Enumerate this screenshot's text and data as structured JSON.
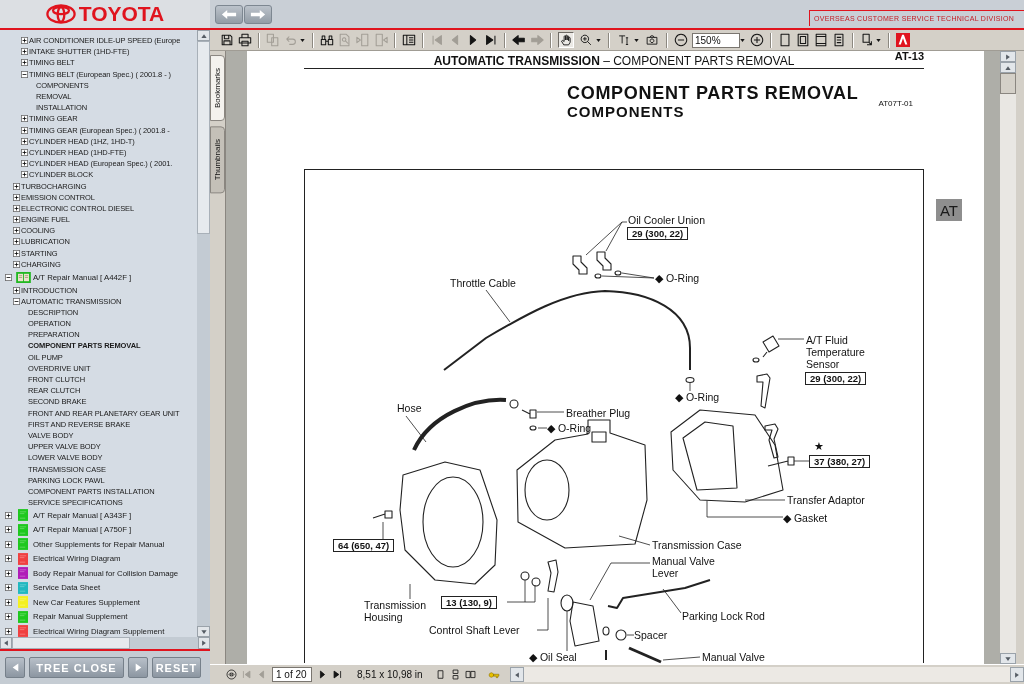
{
  "header": {
    "logo": "TOYOTA",
    "division": "OVERSEAS CUSTOMER SERVICE TECHNICAL DIVISION"
  },
  "tree": {
    "section_items": [
      {
        "label": "AIR CONDITIONER IDLE-UP SPEED (Europe",
        "expanded": false,
        "selected": false
      },
      {
        "label": "INTAKE SHUTTER (1HD-FTE)",
        "expanded": false,
        "selected": false
      },
      {
        "label": "TIMING BELT",
        "expanded": false,
        "selected": false
      },
      {
        "label": "TIMING BELT (European Spec.) ( 2001.8 - )",
        "expanded": true,
        "selected": false,
        "children": [
          {
            "label": "COMPONENTS",
            "selected": false
          },
          {
            "label": "REMOVAL",
            "selected": false
          },
          {
            "label": "INSTALLATION",
            "selected": false
          }
        ]
      },
      {
        "label": "TIMING GEAR",
        "expanded": false,
        "selected": false
      },
      {
        "label": "TIMING GEAR (European Spec.) ( 2001.8 -",
        "expanded": false,
        "selected": false
      },
      {
        "label": "CYLINDER HEAD (1HZ, 1HD-T)",
        "expanded": false,
        "selected": false
      },
      {
        "label": "CYLINDER HEAD (1HD-FTE)",
        "expanded": false,
        "selected": false
      },
      {
        "label": "CYLINDER HEAD (European Spec.) ( 2001.",
        "expanded": false,
        "selected": false
      },
      {
        "label": "CYLINDER BLOCK",
        "expanded": false,
        "selected": false
      }
    ],
    "manual_items": [
      {
        "label": "TURBOCHARGING",
        "expanded": false,
        "selected": false
      },
      {
        "label": "EMISSION CONTROL",
        "expanded": false,
        "selected": false
      },
      {
        "label": "ELECTRONIC CONTROL DIESEL",
        "expanded": false,
        "selected": false
      },
      {
        "label": "ENGINE FUEL",
        "expanded": false,
        "selected": false
      },
      {
        "label": "COOLING",
        "expanded": false,
        "selected": false
      },
      {
        "label": "LUBRICATION",
        "expanded": false,
        "selected": false
      },
      {
        "label": "STARTING",
        "expanded": false,
        "selected": false
      },
      {
        "label": "CHARGING",
        "expanded": false,
        "selected": false
      }
    ],
    "manuals": [
      {
        "label": "A/T Repair Manual [ A442F ]",
        "color": "#22b822",
        "expanded": true,
        "selected": false,
        "children": [
          {
            "label": "INTRODUCTION",
            "expanded": false,
            "selected": false
          },
          {
            "label": "AUTOMATIC TRANSMISSION",
            "expanded": true,
            "selected": false,
            "children": [
              {
                "label": "DESCRIPTION",
                "selected": false
              },
              {
                "label": "OPERATION",
                "selected": false
              },
              {
                "label": "PREPARATION",
                "selected": false
              },
              {
                "label": "COMPONENT PARTS REMOVAL",
                "selected": true
              },
              {
                "label": "OIL PUMP",
                "selected": false
              },
              {
                "label": "OVERDRIVE UNIT",
                "selected": false
              },
              {
                "label": "FRONT CLUTCH",
                "selected": false
              },
              {
                "label": "REAR CLUTCH",
                "selected": false
              },
              {
                "label": "SECOND BRAKE",
                "selected": false
              },
              {
                "label": "FRONT AND REAR PLANETARY GEAR UNIT",
                "selected": false
              },
              {
                "label": "FIRST AND REVERSE BRAKE",
                "selected": false
              },
              {
                "label": "VALVE BODY",
                "selected": false
              },
              {
                "label": "UPPER VALVE BODY",
                "selected": false
              },
              {
                "label": "LOWER VALVE BODY",
                "selected": false
              },
              {
                "label": "TRANSMISSION CASE",
                "selected": false
              },
              {
                "label": "PARKING LOCK PAWL",
                "selected": false
              },
              {
                "label": "COMPONENT PARTS INSTALLATION",
                "selected": false
              },
              {
                "label": "SERVICE SPECIFICATIONS",
                "selected": false
              }
            ]
          }
        ]
      },
      {
        "label": "A/T Repair Manual [ A343F ]",
        "color": "#1ec81e",
        "expanded": false,
        "selected": false
      },
      {
        "label": "A/T Repair Manual [ A750F ]",
        "color": "#1ec81e",
        "expanded": false,
        "selected": false
      },
      {
        "label": "Other Supplements for Repair Manual",
        "color": "#1ec81e",
        "expanded": false,
        "selected": false
      },
      {
        "label": "Electrical Wiring Diagram",
        "color": "#f04040",
        "expanded": false,
        "selected": false
      },
      {
        "label": "Body Repair Manual for Collision Damage",
        "color": "#b01cb8",
        "expanded": false,
        "selected": false
      },
      {
        "label": "Service Data Sheet",
        "color": "#20b8c0",
        "expanded": false,
        "selected": false
      },
      {
        "label": "New Car Features Supplement",
        "color": "#f4f020",
        "expanded": false,
        "selected": false
      },
      {
        "label": "Repair Manual Supplement",
        "color": "#1ec81e",
        "expanded": false,
        "selected": false
      },
      {
        "label": "Electrical Wiring Diagram Supplement",
        "color": "#f04040",
        "expanded": false,
        "selected": false
      }
    ]
  },
  "tree_controls": {
    "close": "TREE CLOSE",
    "reset": "RESET"
  },
  "toolbar": {
    "buttons": [
      {
        "disabled": false
      },
      {
        "disabled": false
      },
      {
        "disabled": true
      },
      {
        "disabled": true
      },
      {
        "disabled": false
      },
      {
        "disabled": true
      },
      {
        "disabled": true
      },
      {
        "disabled": true
      },
      {
        "disabled": false
      },
      {
        "disabled": true
      },
      {
        "disabled": true
      },
      {
        "disabled": false
      },
      {
        "disabled": false
      },
      {
        "disabled": false
      },
      {
        "disabled": true
      }
    ],
    "tools": [
      {
        "selected": true
      },
      {
        "selected": false
      },
      {
        "selected": false
      },
      {
        "selected": false
      }
    ],
    "zoom": "150%"
  },
  "nav_tabs": [
    {
      "label": "Bookmarks",
      "selected": true
    },
    {
      "label": "Thumbnails",
      "selected": false
    }
  ],
  "document": {
    "page_number": "AT-13",
    "running_head": "**AUTOMATIC TRANSMISSION** – COMPONENT PARTS REMOVAL",
    "title": "COMPONENT PARTS REMOVAL",
    "subtitle": "COMPONENTS",
    "figure_code": "AT07T-01",
    "section_tab": "AT",
    "diagram": {
      "callouts": [
        "Oil Cooler Union",
        "◆ O-Ring",
        "Throttle Cable",
        "A/T Fluid Temperature Sensor",
        "◆ O-Ring",
        "Hose",
        "Breather Plug",
        "◆ O-Ring",
        "★",
        "Transfer Adaptor",
        "◆ Gasket",
        "Transmission Case",
        "Manual Valve Lever",
        "Transmission Housing",
        "Parking Lock Rod",
        "Control Shaft Lever",
        "Spacer",
        "◆ Oil Seal",
        "Manual Valve"
      ],
      "torque_specs": [
        "29 (300, 22)",
        "29 (300, 22)",
        "37 (380, 27)",
        "64 (650, 47)",
        "13 (130, 9)"
      ]
    }
  },
  "status_bar": {
    "page_buttons": [
      {
        "disabled": true
      },
      {
        "disabled": true
      },
      {
        "disabled": false
      },
      {
        "disabled": false
      }
    ],
    "page": "1 of 20",
    "page_size": "8,51 x 10,98 in"
  }
}
